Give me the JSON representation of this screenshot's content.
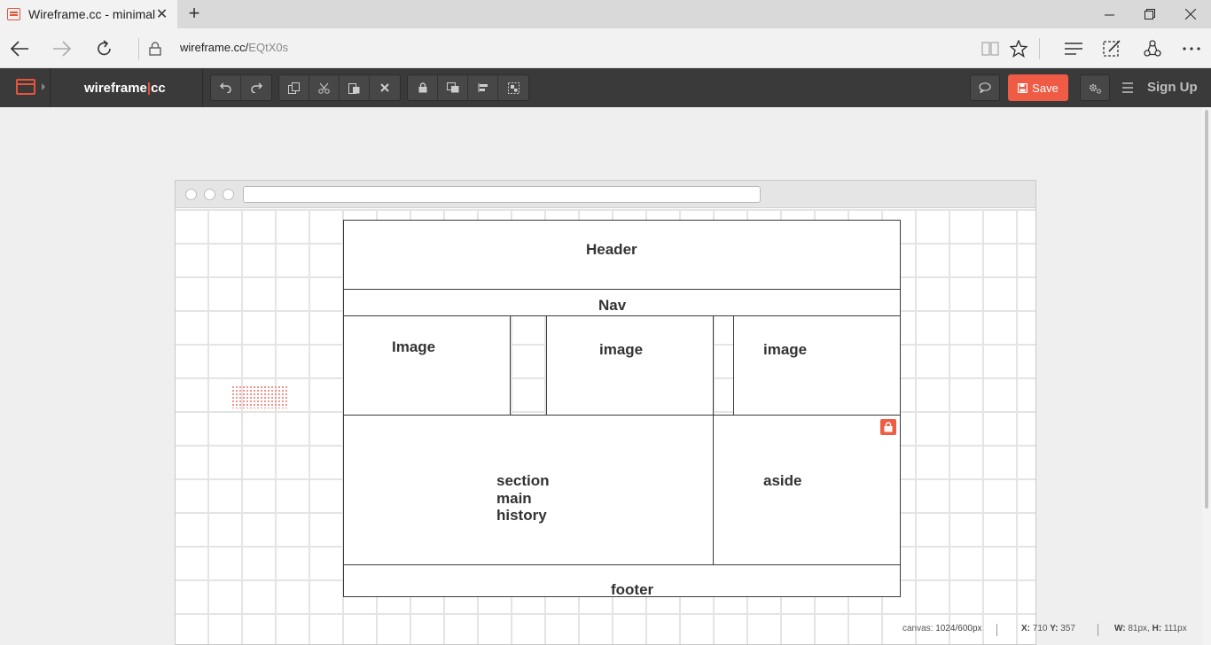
{
  "browser": {
    "tab_title": "Wireframe.cc - minimal",
    "new_tab_symbol": "+",
    "url_host": "wireframe.cc/",
    "url_path": "EQtX0s"
  },
  "toolbar": {
    "brand_left": "wireframe",
    "brand_bar": "|",
    "brand_right": "cc",
    "save_label": "Save",
    "signup_label": "Sign Up",
    "accent_color": "#ef5b45"
  },
  "wireframe": {
    "header": "Header",
    "nav": "Nav",
    "image1": "Image",
    "image2": "image",
    "image3": "image",
    "section_line1": "section",
    "section_line2": "main",
    "section_line3": "history",
    "aside": "aside",
    "footer": "footer"
  },
  "status": {
    "canvas_label": "canvas:",
    "canvas_value": "1024/600px",
    "x_label": "X:",
    "x_value": "710",
    "y_label": "Y:",
    "y_value": "357",
    "w_label": "W:",
    "w_value": "81px,",
    "h_label": "H:",
    "h_value": "111px"
  }
}
